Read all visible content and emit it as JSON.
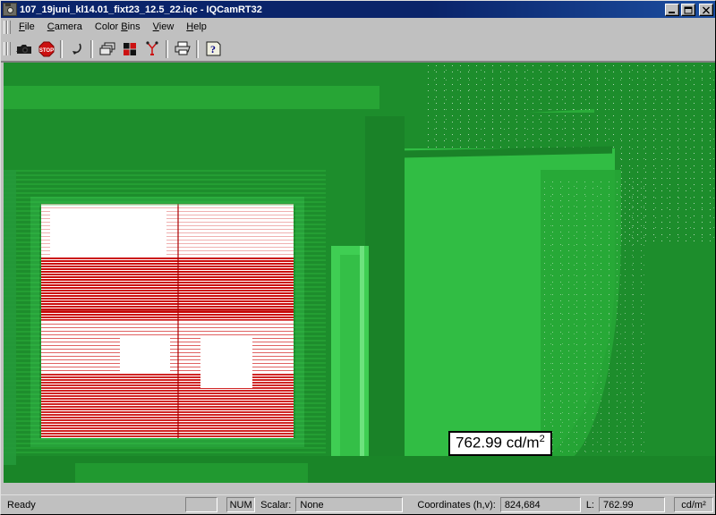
{
  "window": {
    "title": "107_19juni_kl14.01_fixt23_12.5_22.iqc - IQCamRT32",
    "icon": "camera-icon",
    "controls": {
      "minimize": "Minimize",
      "maximize": "Maximize",
      "close": "Close"
    }
  },
  "menu": {
    "items": [
      {
        "label": "File",
        "accel": "F"
      },
      {
        "label": "Camera",
        "accel": "C"
      },
      {
        "label": "Color Bins",
        "accel": "B"
      },
      {
        "label": "View",
        "accel": "V"
      },
      {
        "label": "Help",
        "accel": "H"
      }
    ]
  },
  "toolbar": {
    "buttons": [
      {
        "name": "capture-camera-icon",
        "label": "Capture"
      },
      {
        "name": "stop-icon",
        "label": "Stop"
      },
      {
        "name": "undo-arrow-icon",
        "label": "Undo"
      },
      {
        "name": "layers-copy-icon",
        "label": "Copy"
      },
      {
        "name": "color-bins-icon",
        "label": "Color Bins"
      },
      {
        "name": "measure-tool-icon",
        "label": "Measure"
      },
      {
        "name": "print-icon",
        "label": "Print"
      },
      {
        "name": "help-icon",
        "label": "Help"
      }
    ]
  },
  "image": {
    "name": "luminance-false-color-image",
    "callout": {
      "value": "762.99",
      "unit_base": " cd/m",
      "unit_sup": "2",
      "full_text": "762.99 cd/m²"
    },
    "colors": {
      "green_dark": "#1c8a2b",
      "green_mid": "#22a032",
      "green_bright": "#35c44a",
      "saturated_white": "#ffffff",
      "scanline_red": "#cc0000"
    }
  },
  "status_bar": {
    "ready_text": "Ready",
    "spacer_text": "",
    "num_indicator": "NUM",
    "scalar_label": "Scalar:",
    "scalar_value": "None",
    "coordinates_label": "Coordinates (h,v):",
    "coordinates_value": "824,684",
    "luminance_label": "L:",
    "luminance_value": "762.99",
    "unit_value": "cd/m²"
  }
}
